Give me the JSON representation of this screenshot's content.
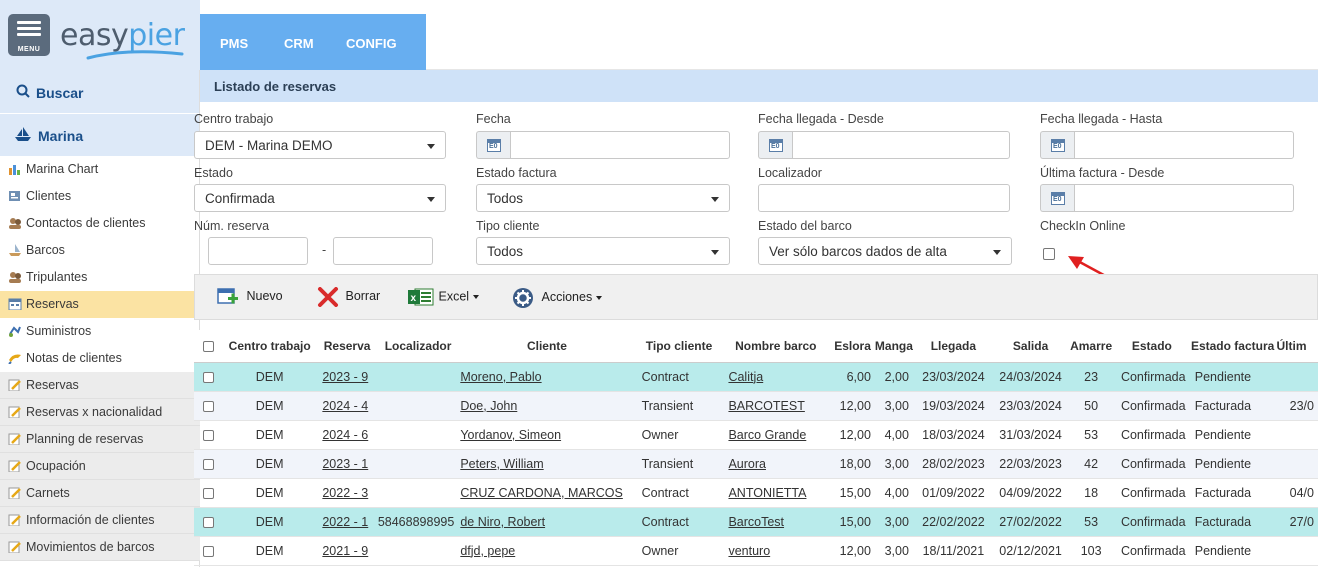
{
  "app": {
    "logo_text_a": "easy",
    "logo_text_b": "pier",
    "menu_label": "MENU",
    "modules": [
      "PMS",
      "CRM",
      "CONFIG"
    ]
  },
  "sidebar": {
    "search_label": "Buscar",
    "section_label": "Marina",
    "items": [
      {
        "label": "Marina Chart",
        "icon": "chart-icon"
      },
      {
        "label": "Clientes",
        "icon": "clients-icon"
      },
      {
        "label": "Contactos de clientes",
        "icon": "contacts-icon"
      },
      {
        "label": "Barcos",
        "icon": "boat-icon"
      },
      {
        "label": "Tripulantes",
        "icon": "crew-icon"
      },
      {
        "label": "Reservas",
        "icon": "reservations-icon"
      },
      {
        "label": "Suministros",
        "icon": "supplies-icon"
      },
      {
        "label": "Notas de clientes",
        "icon": "notes-icon"
      }
    ],
    "report_items": [
      "Reservas",
      "Reservas x nacionalidad",
      "Planning de reservas",
      "Ocupación",
      "Carnets",
      "Información de clientes",
      "Movimientos de barcos"
    ]
  },
  "page": {
    "title": "Listado de reservas"
  },
  "filters": {
    "centro_trabajo": {
      "label": "Centro trabajo",
      "value": "DEM - Marina DEMO"
    },
    "fecha": {
      "label": "Fecha",
      "value": ""
    },
    "fecha_llegada_desde": {
      "label": "Fecha llegada - Desde",
      "value": ""
    },
    "fecha_llegada_hasta": {
      "label": "Fecha llegada - Hasta",
      "value": ""
    },
    "estado": {
      "label": "Estado",
      "value": "Confirmada"
    },
    "estado_factura": {
      "label": "Estado factura",
      "value": "Todos"
    },
    "localizador": {
      "label": "Localizador",
      "value": ""
    },
    "ultima_factura_desde": {
      "label": "Última factura - Desde",
      "value": ""
    },
    "num_reserva": {
      "label": "Núm. reserva",
      "separator": "-",
      "from": "",
      "to": ""
    },
    "tipo_cliente": {
      "label": "Tipo cliente",
      "value": "Todos"
    },
    "estado_barco": {
      "label": "Estado del barco",
      "value": "Ver sólo barcos dados de alta"
    },
    "checkin_online": {
      "label": "CheckIn Online",
      "checked": false
    }
  },
  "toolbar": {
    "nuevo": "Nuevo",
    "borrar": "Borrar",
    "excel": "Excel",
    "acciones": "Acciones"
  },
  "table": {
    "headers": [
      "Centro trabajo",
      "Reserva",
      "Localizador",
      "Cliente",
      "Tipo cliente",
      "Nombre barco",
      "Eslora",
      "Manga",
      "Llegada",
      "Salida",
      "Amarre",
      "Estado",
      "Estado factura",
      "Últim"
    ],
    "rows": [
      {
        "centro": "DEM",
        "reserva": "2023 - 9",
        "localizador": "",
        "cliente": "Moreno, Pablo",
        "tipo": "Contract",
        "barco": "Calitja",
        "eslora": "6,00",
        "manga": "2,00",
        "llegada": "23/03/2024",
        "salida": "24/03/2024",
        "amarre": "23",
        "estado": "Confirmada",
        "factura": "Pendiente",
        "ultima": ""
      },
      {
        "centro": "DEM",
        "reserva": "2024 - 4",
        "localizador": "",
        "cliente": "Doe, John",
        "tipo": "Transient",
        "barco": "BARCOTEST",
        "eslora": "12,00",
        "manga": "3,00",
        "llegada": "19/03/2024",
        "salida": "23/03/2024",
        "amarre": "50",
        "estado": "Confirmada",
        "factura": "Facturada",
        "ultima": "23/0"
      },
      {
        "centro": "DEM",
        "reserva": "2024 - 6",
        "localizador": "",
        "cliente": "Yordanov, Simeon",
        "tipo": "Owner",
        "barco": "Barco Grande",
        "eslora": "12,00",
        "manga": "4,00",
        "llegada": "18/03/2024",
        "salida": "31/03/2024",
        "amarre": "53",
        "estado": "Confirmada",
        "factura": "Pendiente",
        "ultima": ""
      },
      {
        "centro": "DEM",
        "reserva": "2023 - 1",
        "localizador": "",
        "cliente": "Peters, William",
        "tipo": "Transient",
        "barco": "Aurora",
        "eslora": "18,00",
        "manga": "3,00",
        "llegada": "28/02/2023",
        "salida": "22/03/2023",
        "amarre": "42",
        "estado": "Confirmada",
        "factura": "Pendiente",
        "ultima": ""
      },
      {
        "centro": "DEM",
        "reserva": "2022 - 3",
        "localizador": "",
        "cliente": "CRUZ CARDONA, MARCOS",
        "tipo": "Contract",
        "barco": "ANTONIETTA",
        "eslora": "15,00",
        "manga": "4,00",
        "llegada": "01/09/2022",
        "salida": "04/09/2022",
        "amarre": "18",
        "estado": "Confirmada",
        "factura": "Facturada",
        "ultima": "04/0"
      },
      {
        "centro": "DEM",
        "reserva": "2022 - 1",
        "localizador": "58468898995",
        "cliente": "de Niro, Robert",
        "tipo": "Contract",
        "barco": "BarcoTest",
        "eslora": "15,00",
        "manga": "3,00",
        "llegada": "22/02/2022",
        "salida": "27/02/2022",
        "amarre": "53",
        "estado": "Confirmada",
        "factura": "Facturada",
        "ultima": "27/0"
      },
      {
        "centro": "DEM",
        "reserva": "2021 - 9",
        "localizador": "",
        "cliente": "dfjd, pepe",
        "tipo": "Owner",
        "barco": "venturo",
        "eslora": "12,00",
        "manga": "3,00",
        "llegada": "18/11/2021",
        "salida": "02/12/2021",
        "amarre": "103",
        "estado": "Confirmada",
        "factura": "Pendiente",
        "ultima": ""
      }
    ]
  },
  "colors": {
    "accent": "#67aef0",
    "highlight_row": "#b9ebeb",
    "active_item": "#fbe3a3",
    "arrow": "#e02020"
  }
}
